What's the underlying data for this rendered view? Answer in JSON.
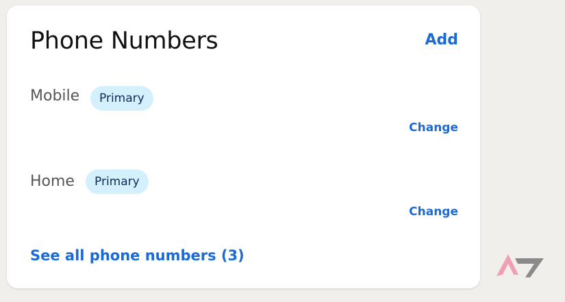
{
  "card": {
    "title": "Phone Numbers",
    "add_label": "Add",
    "rows": [
      {
        "label": "Mobile",
        "badge": "Primary",
        "change_label": "Change"
      },
      {
        "label": "Home",
        "badge": "Primary",
        "change_label": "Change"
      }
    ],
    "see_all_label": "See all phone numbers (3)"
  },
  "colors": {
    "link": "#1a6bd6",
    "badge_bg": "#d3f0fc",
    "badge_text": "#0d2a57",
    "page_bg": "#f1efec",
    "watermark_pink": "#f0a0b2",
    "watermark_gray": "#8a8a8a"
  },
  "icons": {
    "watermark": "android-police-logo"
  }
}
